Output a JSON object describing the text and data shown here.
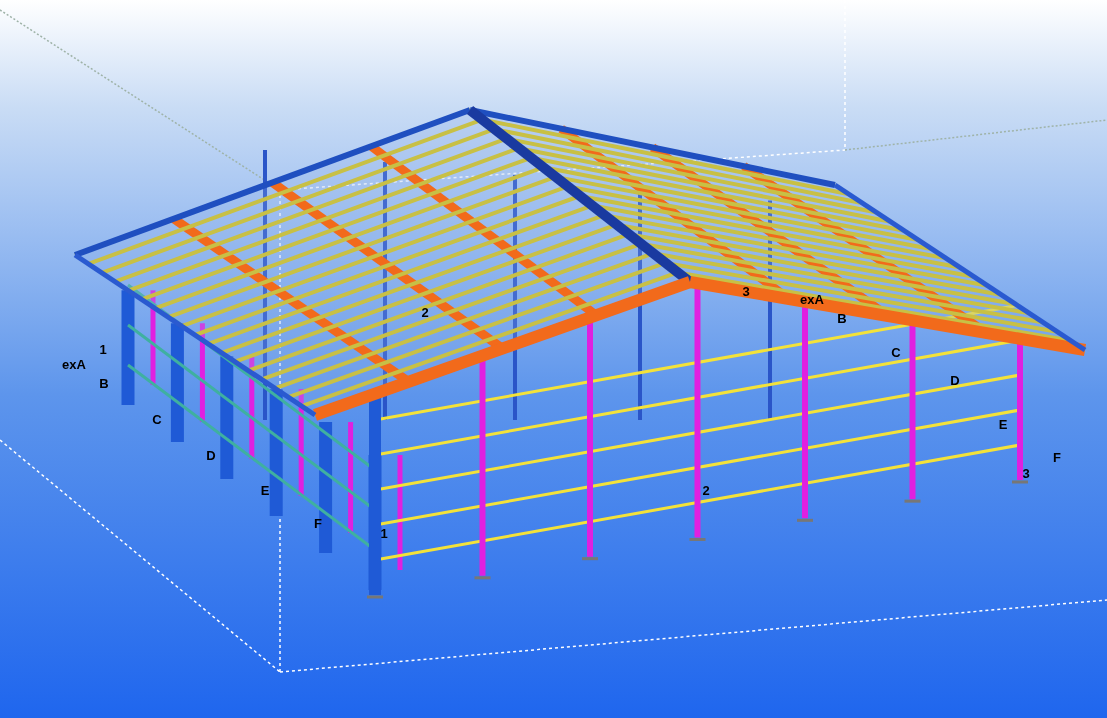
{
  "viewport": {
    "grid_labels": [
      {
        "text": "1"
      },
      {
        "text": "exA"
      },
      {
        "text": "B"
      },
      {
        "text": "C"
      },
      {
        "text": "D"
      },
      {
        "text": "E"
      },
      {
        "text": "F"
      },
      {
        "text": "1"
      },
      {
        "text": "2"
      },
      {
        "text": "2"
      },
      {
        "text": "3"
      },
      {
        "text": "exA"
      },
      {
        "text": "B"
      },
      {
        "text": "C"
      },
      {
        "text": "D"
      },
      {
        "text": "E"
      },
      {
        "text": "F"
      },
      {
        "text": "3"
      }
    ]
  }
}
